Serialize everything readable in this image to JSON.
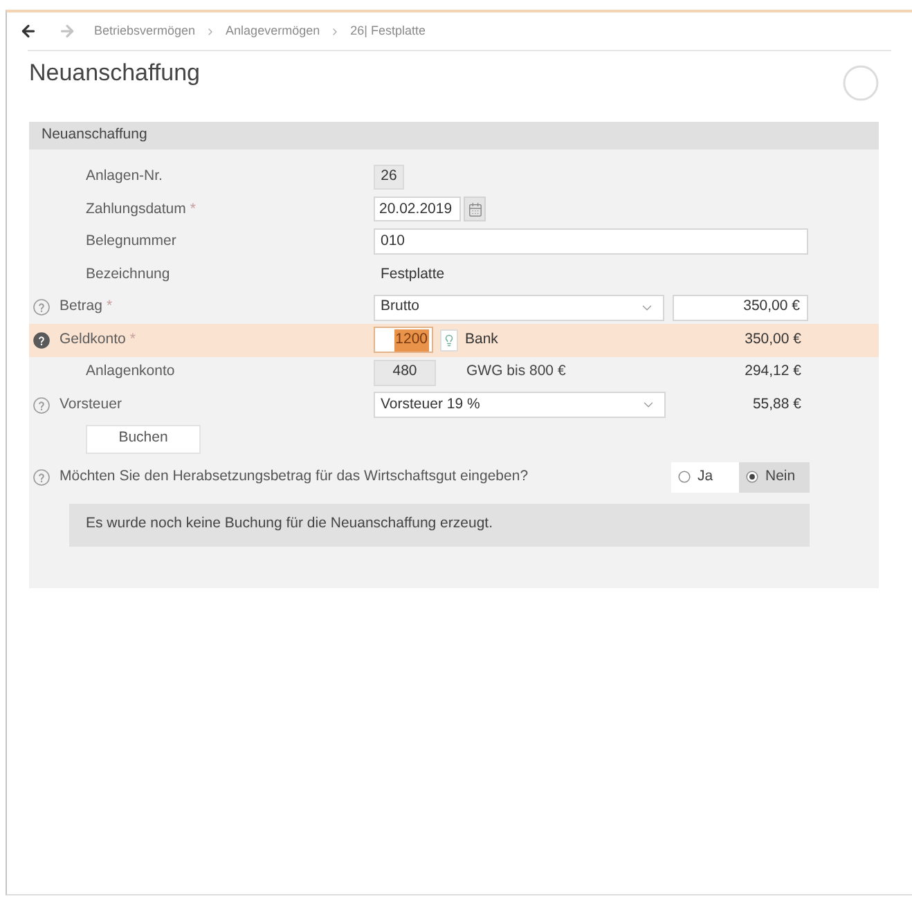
{
  "breadcrumb": {
    "back_enabled": true,
    "forward_enabled": false,
    "items": [
      "Betriebsvermögen",
      "Anlagevermögen",
      "26| Festplatte"
    ]
  },
  "title": "Neuanschaffung",
  "panel": {
    "header": "Neuanschaffung",
    "rows": [
      {
        "kind": "readonly_box",
        "label": "Anlagen-Nr.",
        "help": false,
        "highlighted": false,
        "value": "26"
      },
      {
        "kind": "date",
        "label": "Zahlungsdatum",
        "required": "*",
        "help": false,
        "highlighted": false,
        "value": "20.02.2019"
      },
      {
        "kind": "input",
        "label": "Belegnummer",
        "help": false,
        "highlighted": false,
        "value": "010"
      },
      {
        "kind": "text",
        "label": "Bezeichnung",
        "help": false,
        "highlighted": false,
        "value": "Festplatte"
      },
      {
        "kind": "select_amount",
        "label": "Betrag",
        "required": "*",
        "help": true,
        "highlighted": false,
        "value": "Brutto",
        "amount": "350,00 €"
      },
      {
        "kind": "account",
        "label": "Geldkonto",
        "required": "*",
        "help": true,
        "highlighted": true,
        "value": "1200",
        "value_selected": true,
        "account_name": "Bank",
        "amount": "350,00 €"
      },
      {
        "kind": "account_box",
        "label": "Anlagenkonto",
        "help": false,
        "highlighted": false,
        "value": "480",
        "note": "GWG bis 800 €",
        "amount": "294,12 €"
      },
      {
        "kind": "select",
        "label": "Vorsteuer",
        "help": true,
        "highlighted": false,
        "value": "Vorsteuer 19 %",
        "amount": "55,88 €"
      }
    ],
    "button": "Buchen",
    "question": {
      "help": true,
      "text": "Möchten Sie den Herabsetzungsbetrag für das Wirtschaftsgut eingeben?",
      "options": [
        {
          "label": "Ja",
          "selected": false
        },
        {
          "label": "Nein",
          "selected": true
        }
      ]
    },
    "message": "Es wurde noch keine Buchung für die Neuanschaffung erzeugt."
  }
}
